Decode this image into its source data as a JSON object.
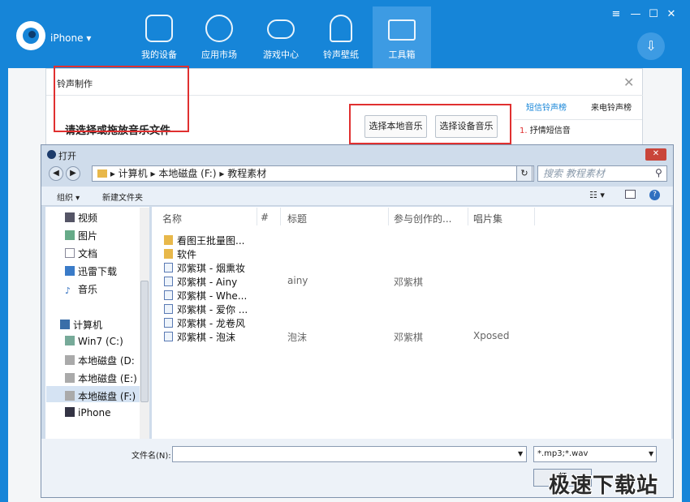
{
  "app": {
    "device": "iPhone ▾"
  },
  "nav": [
    {
      "label": "我的设备",
      "icon": "tablet-icon"
    },
    {
      "label": "应用市场",
      "icon": "apps-grid-icon"
    },
    {
      "label": "游戏中心",
      "icon": "gamepad-icon"
    },
    {
      "label": "铃声壁纸",
      "icon": "bell-icon"
    },
    {
      "label": "工具箱",
      "icon": "toolbox-icon"
    }
  ],
  "window_controls": {
    "menu": "≡",
    "minimize": "—",
    "maximize": "☐",
    "close": "✕"
  },
  "ringtone": {
    "title": "铃声制作",
    "hint": "请选择或拖放音乐文件",
    "btn_local": "选择本地音乐",
    "btn_device": "选择设备音乐",
    "tab_sms": "短信铃声榜",
    "tab_call": "来电铃声榜",
    "hot_rank": "1.",
    "hot_item": "抒情短信音"
  },
  "dialog": {
    "title": "打开",
    "address": [
      "计算机",
      "本地磁盘 (F:)",
      "教程素材"
    ],
    "search_placeholder": "搜索 教程素材",
    "organize": "组织 ▾",
    "new_folder": "新建文件夹",
    "nav_items": [
      {
        "label": "视频",
        "icon": "video-icon"
      },
      {
        "label": "图片",
        "icon": "picture-icon"
      },
      {
        "label": "文档",
        "icon": "document-icon"
      },
      {
        "label": "迅雷下载",
        "icon": "download-icon"
      },
      {
        "label": "音乐",
        "icon": "music-icon"
      }
    ],
    "computer": "计算机",
    "drives": [
      "Win7 (C:)",
      "本地磁盘 (D:",
      "本地磁盘 (E:)",
      "本地磁盘 (F:)",
      "iPhone"
    ],
    "columns": [
      "名称",
      "#",
      "标题",
      "参与创作的...",
      "唱片集"
    ],
    "files": [
      {
        "name": "看图王批量图...",
        "type": "folder",
        "title": "",
        "artist": "",
        "album": ""
      },
      {
        "name": "软件",
        "type": "folder",
        "title": "",
        "artist": "",
        "album": ""
      },
      {
        "name": "邓紫琪 - 烟熏妆",
        "type": "music",
        "title": "",
        "artist": "",
        "album": ""
      },
      {
        "name": "邓紫棋 - Ainy",
        "type": "music",
        "title": "ainy",
        "artist": "邓紫棋",
        "album": ""
      },
      {
        "name": "邓紫棋 - Whe...",
        "type": "music",
        "title": "",
        "artist": "",
        "album": ""
      },
      {
        "name": "邓紫棋 - 爱你 ...",
        "type": "music",
        "title": "",
        "artist": "",
        "album": ""
      },
      {
        "name": "邓紫棋 - 龙卷风",
        "type": "music",
        "title": "",
        "artist": "",
        "album": ""
      },
      {
        "name": "邓紫棋 - 泡沫",
        "type": "music",
        "title": "泡沫",
        "artist": "邓紫棋",
        "album": "Xposed"
      }
    ],
    "filename_label": "文件名(N):",
    "filename_value": "",
    "filter": "*.mp3;*.wav",
    "open_btn": "打"
  },
  "watermark": "极速下载站",
  "colors": {
    "brand": "#1685d8",
    "highlight": "#e03030"
  }
}
